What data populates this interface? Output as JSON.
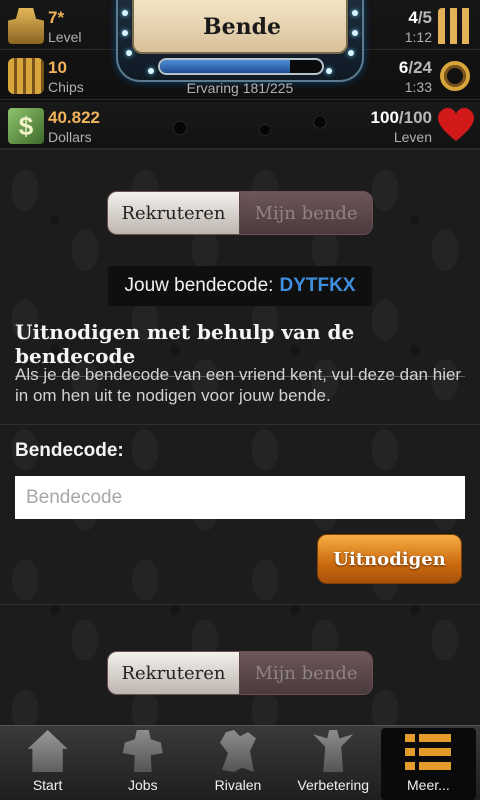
{
  "header": {
    "title": "Bende",
    "experience": {
      "label": "Ervaring 181/225",
      "current": 181,
      "max": 225
    },
    "stats_left": [
      {
        "value": "7*",
        "label": "Level",
        "icon": "fedora-icon"
      },
      {
        "value": "10",
        "label": "Chips",
        "icon": "chips-icon"
      },
      {
        "value": "40.822",
        "label": "Dollars",
        "icon": "dollar-icon"
      }
    ],
    "stats_right": [
      {
        "value": "4",
        "max": "/5",
        "timer": "1:12",
        "icon": "ammo-icon"
      },
      {
        "value": "6",
        "max": "/24",
        "timer": "1:33",
        "icon": "brass-knuckles-icon"
      },
      {
        "value": "100",
        "max": "/100",
        "timer": "Leven",
        "icon": "heart-icon"
      }
    ]
  },
  "tabs": {
    "recruit": "Rekruteren",
    "my_gang": "Mijn bende",
    "active": "recruit"
  },
  "gang_code": {
    "label": "Jouw bendecode:",
    "code": "DYTFKX"
  },
  "invite": {
    "title": "Uitnodigen met behulp van de bendecode",
    "description": "Als je de bendecode van een vriend kent, vul deze dan hier in om hen uit te nodigen voor jouw bende.",
    "field_label": "Bendecode:",
    "placeholder": "Bendecode",
    "value": "",
    "button": "Uitnodigen"
  },
  "bottom_tabs": {
    "recruit": "Rekruteren",
    "my_gang": "Mijn bende"
  },
  "nav": [
    {
      "label": "Start",
      "icon": "home-icon"
    },
    {
      "label": "Jobs",
      "icon": "gangster-icon"
    },
    {
      "label": "Rivalen",
      "icon": "rivals-icon"
    },
    {
      "label": "Verbetering",
      "icon": "upgrade-icon"
    },
    {
      "label": "Meer...",
      "icon": "menu-list-icon",
      "active": true
    }
  ],
  "colors": {
    "accent": "#f0b35a",
    "code": "#3f8fe0",
    "button": "#cb6a10",
    "heart": "#d11919"
  }
}
